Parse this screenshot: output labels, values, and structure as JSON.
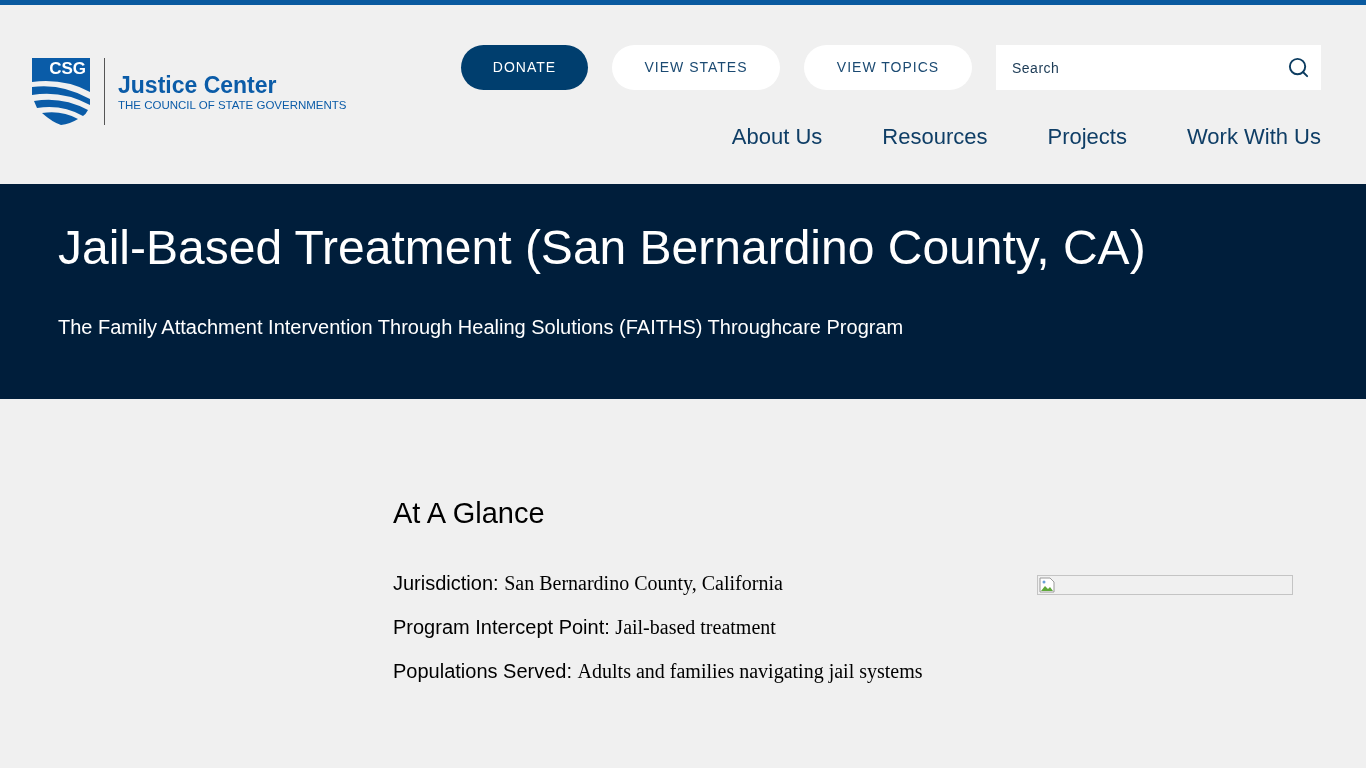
{
  "logo": {
    "mark": "CSG",
    "name": "Justice Center",
    "tagline": "THE COUNCIL OF STATE GOVERNMENTS"
  },
  "header_buttons": [
    {
      "label": "DONATE",
      "kind": "primary"
    },
    {
      "label": "VIEW STATES",
      "kind": "secondary"
    },
    {
      "label": "VIEW TOPICS",
      "kind": "secondary"
    }
  ],
  "search": {
    "placeholder": "Search"
  },
  "nav": [
    "About Us",
    "Resources",
    "Projects",
    "Work With Us"
  ],
  "banner": {
    "title": "Jail-Based Treatment (San Bernardino County, CA)",
    "subtitle": "The Family Attachment Intervention Through Healing Solutions (FAITHS) Throughcare Program"
  },
  "at_a_glance": {
    "heading": "At A Glance",
    "facts": [
      {
        "label": "Jurisdiction:",
        "value": "San Bernardino County, California"
      },
      {
        "label": "Program Intercept Point:",
        "value": "Jail-based treatment"
      },
      {
        "label": "Populations Served:",
        "value": "Adults and families navigating jail systems"
      }
    ]
  }
}
